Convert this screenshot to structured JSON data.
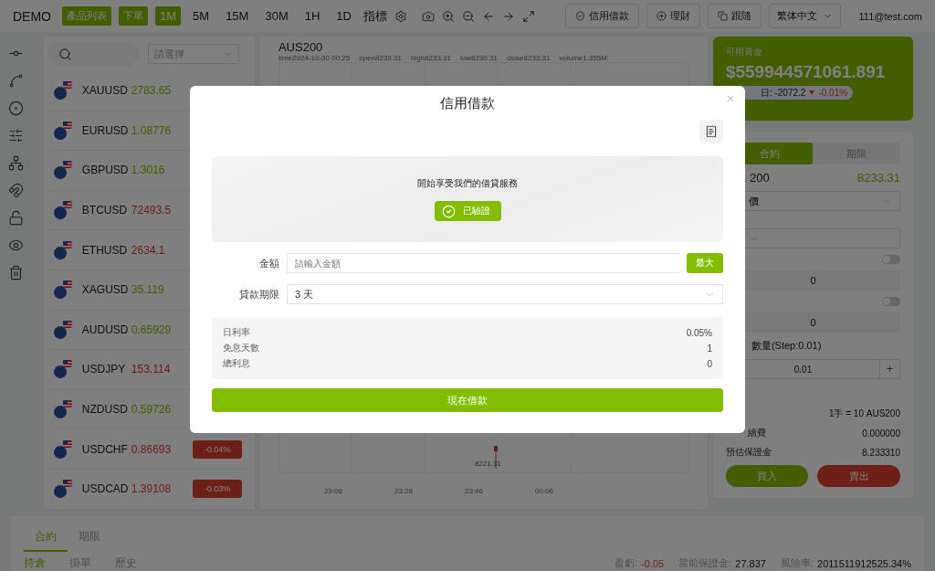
{
  "topbar": {
    "brand": "DEMO",
    "buttons": [
      {
        "label": "產品列表"
      },
      {
        "label": "下單"
      }
    ],
    "timeframes": [
      {
        "label": "1M",
        "selected": true
      },
      {
        "label": "5M",
        "selected": false
      },
      {
        "label": "15M",
        "selected": false
      },
      {
        "label": "30M",
        "selected": false
      },
      {
        "label": "1H",
        "selected": false
      },
      {
        "label": "1D",
        "selected": false
      }
    ],
    "indicator": "指標",
    "links": [
      {
        "label": "信用借款"
      },
      {
        "label": "理財"
      },
      {
        "label": "跟隨"
      }
    ],
    "language": "繁体中文",
    "user": "111@test.com"
  },
  "market": {
    "filter_placeholder": "請選擇",
    "rows": [
      {
        "symbol": "XAUUSD",
        "price": "2783.65",
        "negative": false
      },
      {
        "symbol": "EURUSD",
        "price": "1.08776",
        "negative": false
      },
      {
        "symbol": "GBPUSD",
        "price": "1.3016",
        "negative": false
      },
      {
        "symbol": "BTCUSD",
        "price": "72493.5",
        "negative": true
      },
      {
        "symbol": "ETHUSD",
        "price": "2634.1",
        "negative": true
      },
      {
        "symbol": "XAGUSD",
        "price": "35.119",
        "negative": false
      },
      {
        "symbol": "AUDUSD",
        "price": "0.65929",
        "negative": false
      },
      {
        "symbol": "USDJPY",
        "price": "153.114",
        "negative": true
      },
      {
        "symbol": "NZDUSD",
        "price": "0.59726",
        "negative": false
      },
      {
        "symbol": "USDCHF",
        "price": "0.86693",
        "negative": true,
        "change": "-0.04%"
      },
      {
        "symbol": "USDCAD",
        "price": "1.39108",
        "negative": true,
        "change": "-0.03%"
      }
    ]
  },
  "chart": {
    "symbol": "AUS200",
    "ohlc": [
      "time2024-10-30 00:25",
      "open8233.31",
      "high8233.31",
      "low8230.31",
      "close8233.31",
      "volume1.355M"
    ],
    "price_label": "8221.31",
    "x_labels": [
      "23:06",
      "23:26",
      "23:46",
      "00:06"
    ]
  },
  "account": {
    "label": "可用資金",
    "balance": "$559944571061.891",
    "today": "日: -2072.2",
    "change": "-0.01%"
  },
  "order": {
    "tabs": [
      {
        "label": "合約",
        "selected": true
      },
      {
        "label": "期限",
        "selected": false
      }
    ],
    "symbol": "200",
    "price": "8233.31",
    "type_value": "價",
    "toggles": [
      {
        "on": false,
        "value": "0"
      },
      {
        "on": false,
        "value": "0"
      }
    ],
    "quantity_label": "數量(Step:0.01)",
    "quantity": "0.01",
    "step_button": "+",
    "contract_size": "1手 = 10 AUS200",
    "details": [
      {
        "label": "續費",
        "value": "0.000000"
      },
      {
        "label": "預估保證金",
        "value": "8.233310"
      }
    ],
    "buy": "買入",
    "sell": "賣出"
  },
  "positions": {
    "tabs": [
      {
        "label": "合約",
        "selected": true
      },
      {
        "label": "期限",
        "selected": false
      }
    ],
    "subtabs": [
      {
        "label": "持倉",
        "selected": true
      },
      {
        "label": "掛單",
        "selected": false
      },
      {
        "label": "歷史",
        "selected": false
      }
    ],
    "stats": [
      {
        "label": "盈虧:",
        "value": "-0.05",
        "negative": true
      },
      {
        "label": "當前保證金:",
        "value": "27.837",
        "negative": false
      },
      {
        "label": "風險率:",
        "value": "2011511912525.34%",
        "negative": false
      }
    ]
  },
  "modal": {
    "title": "信用借款",
    "banner_text": "開始享受我們的借貸服務",
    "verified": "已驗證",
    "amount_label": "金額",
    "amount_placeholder": "請輸入金額",
    "max_button": "最大",
    "term_label": "貸款期限",
    "term_value": "3 天",
    "summary": [
      {
        "label": "日利率",
        "value": "0.05%"
      },
      {
        "label": "免息天數",
        "value": "1"
      },
      {
        "label": "總利息",
        "value": "0"
      }
    ],
    "submit": "現在借款"
  }
}
